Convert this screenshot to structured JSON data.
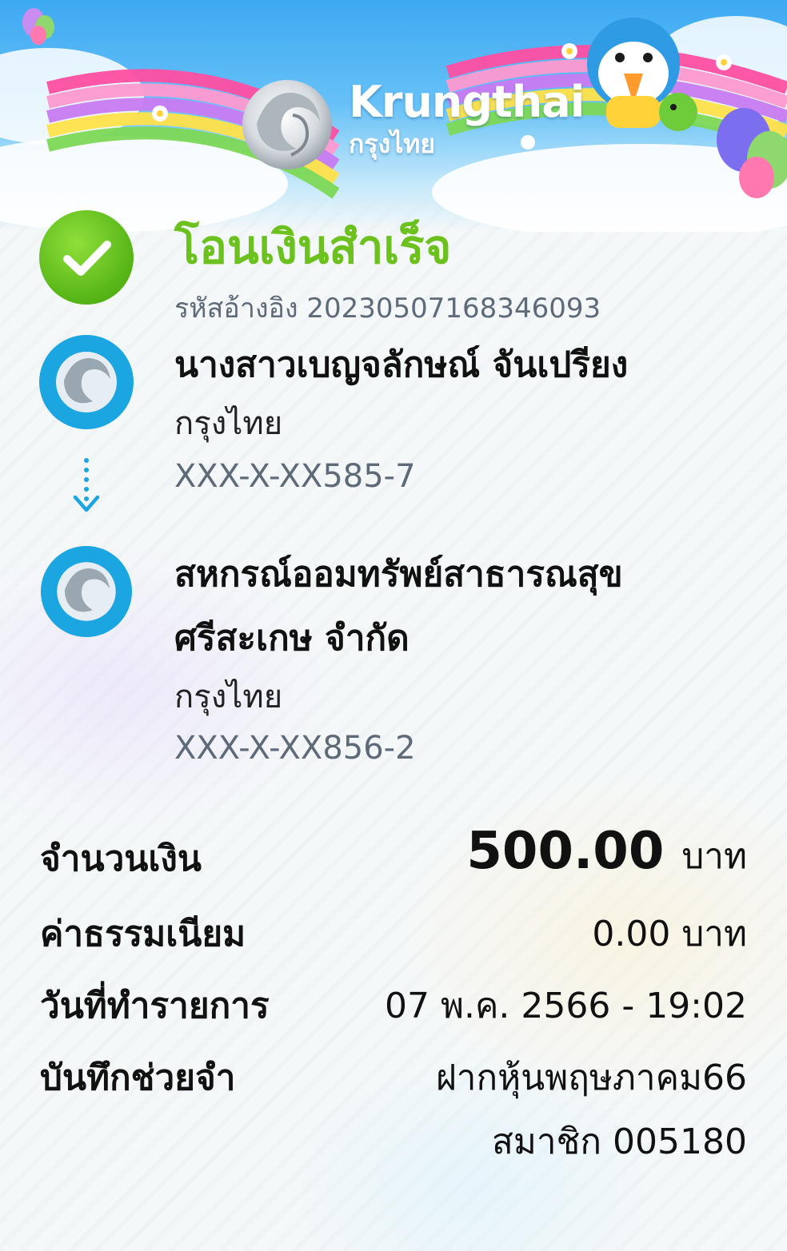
{
  "header": {
    "brand_en": "Krungthai",
    "brand_th": "กรุงไทย"
  },
  "status": {
    "title": "โอนเงินสำเร็จ",
    "reference": "รหัสอ้างอิง 20230507168346093",
    "icon": "check-icon",
    "color": "#6cc11f"
  },
  "sender": {
    "name": "นางสาวเบญจลักษณ์ จันเปรียง",
    "bank": "กรุงไทย",
    "account": "XXX-X-XX585-7",
    "icon": "krungthai-logo-icon"
  },
  "receiver": {
    "name_line1": "สหกรณ์ออมทรัพย์สาธารณสุข",
    "name_line2": "ศรีสะเกษ จำกัด",
    "bank": "กรุงไทย",
    "account": "XXX-X-XX856-2",
    "icon": "krungthai-logo-icon"
  },
  "details": {
    "amount_label": "จำนวนเงิน",
    "amount_value": "500.00",
    "amount_unit": "บาท",
    "fee_label": "ค่าธรรมเนียม",
    "fee_value": "0.00 บาท",
    "date_label": "วันที่ทำรายการ",
    "date_value": "07 พ.ค. 2566 - 19:02",
    "memo_label": "บันทึกช่วยจำ",
    "memo_line1": "ฝากหุ้นพฤษภาคม66",
    "memo_line2": "สมาชิก 005180"
  },
  "colors": {
    "accent_green": "#6cc11f",
    "bank_blue": "#1ba5e1",
    "arrow_blue": "#1ba5e1"
  }
}
